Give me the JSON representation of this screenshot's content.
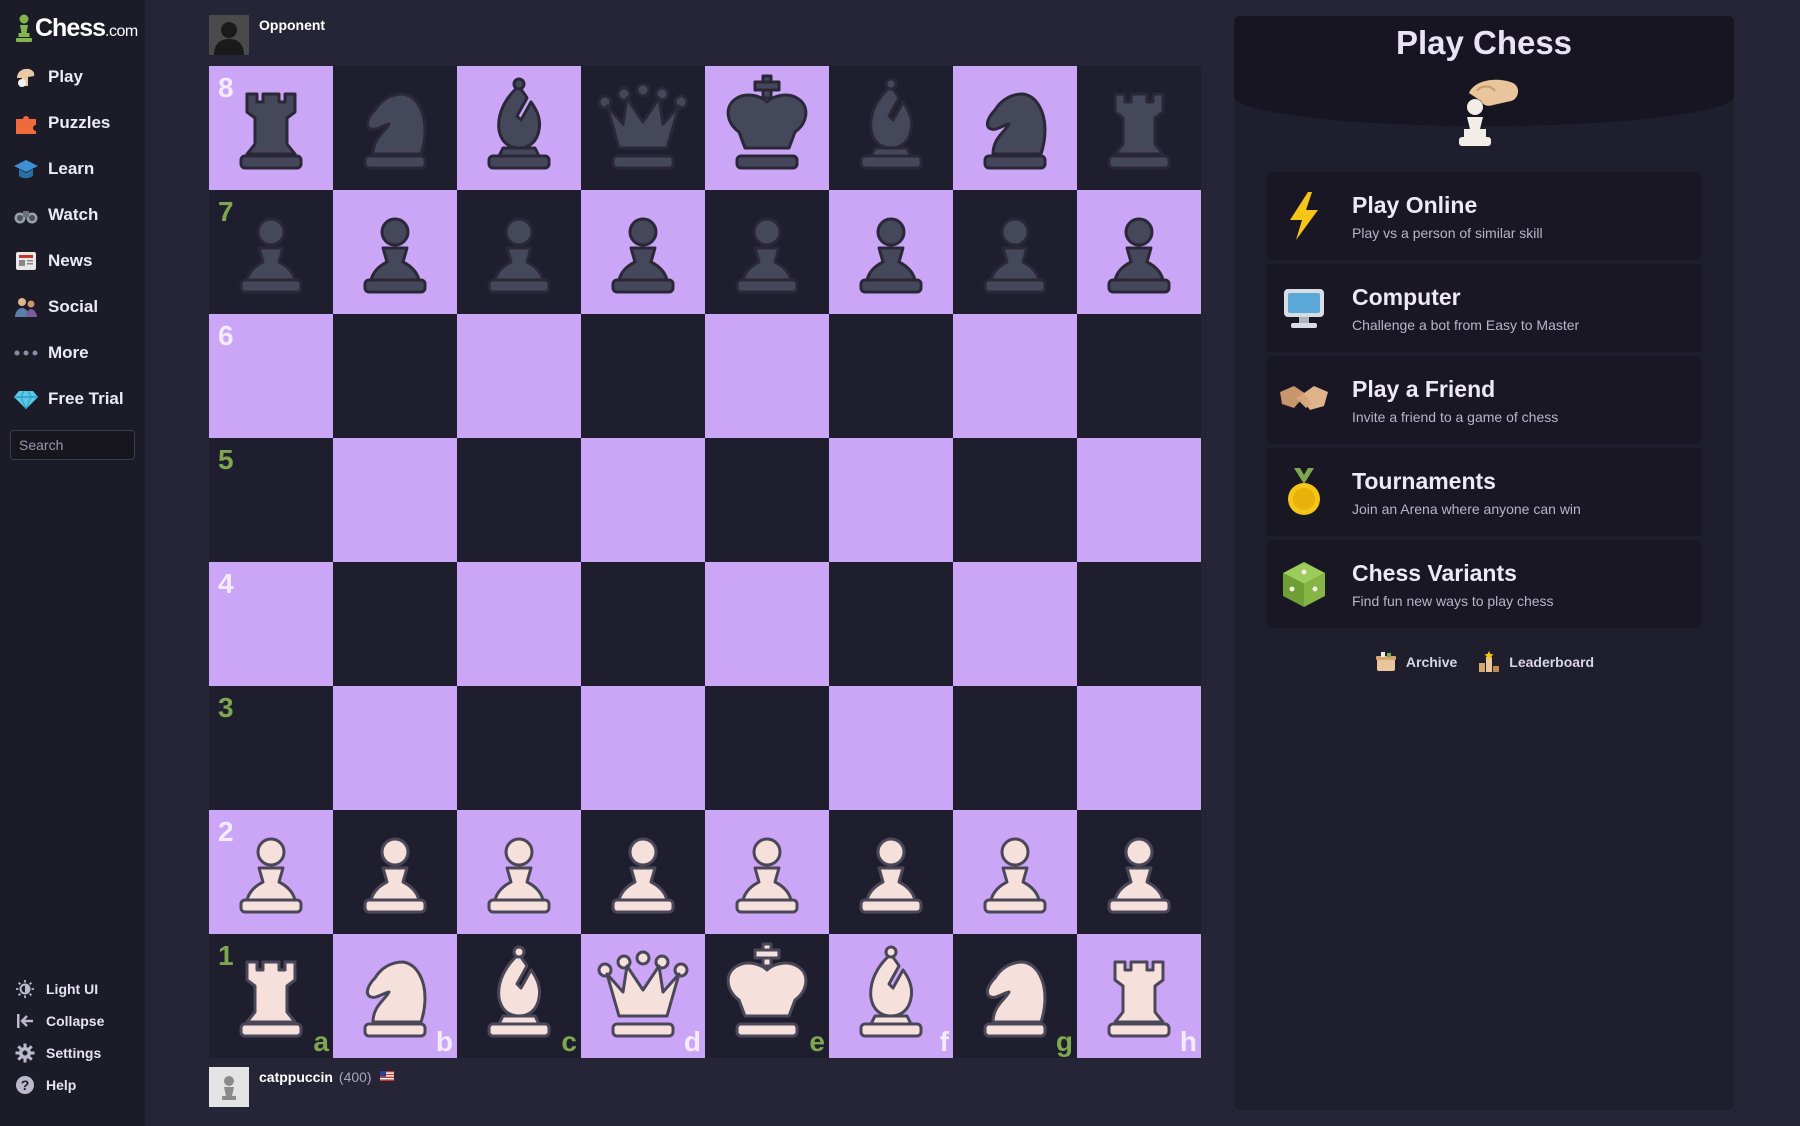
{
  "logo": {
    "brand": "Chess",
    "suffix": ".com"
  },
  "nav": [
    {
      "label": "Play",
      "icon": "play-hand-icon"
    },
    {
      "label": "Puzzles",
      "icon": "puzzle-icon"
    },
    {
      "label": "Learn",
      "icon": "learn-cap-icon"
    },
    {
      "label": "Watch",
      "icon": "binoculars-icon"
    },
    {
      "label": "News",
      "icon": "newspaper-icon"
    },
    {
      "label": "Social",
      "icon": "people-icon"
    },
    {
      "label": "More",
      "icon": "more-dots-icon"
    },
    {
      "label": "Free Trial",
      "icon": "diamond-icon"
    }
  ],
  "search": {
    "placeholder": "Search"
  },
  "bottom_nav": [
    {
      "label": "Light UI",
      "icon": "sun-icon"
    },
    {
      "label": "Collapse",
      "icon": "collapse-icon"
    },
    {
      "label": "Settings",
      "icon": "gear-icon"
    },
    {
      "label": "Help",
      "icon": "help-icon"
    }
  ],
  "opponent": {
    "name": "Opponent"
  },
  "player": {
    "name": "catppuccin",
    "rating": "(400)",
    "flag": "us-flag-icon"
  },
  "board": {
    "light_color": "#cba6f7",
    "dark_color": "#1f1e2e",
    "white_piece_color": "#f5e0dc",
    "black_piece_color": "#45475a",
    "ranks": [
      "8",
      "7",
      "6",
      "5",
      "4",
      "3",
      "2",
      "1"
    ],
    "files": [
      "a",
      "b",
      "c",
      "d",
      "e",
      "f",
      "g",
      "h"
    ],
    "position": [
      [
        "br",
        "bn",
        "bb",
        "bq",
        "bk",
        "bb",
        "bn",
        "br"
      ],
      [
        "bp",
        "bp",
        "bp",
        "bp",
        "bp",
        "bp",
        "bp",
        "bp"
      ],
      [
        "",
        "",
        "",
        "",
        "",
        "",
        "",
        ""
      ],
      [
        "",
        "",
        "",
        "",
        "",
        "",
        "",
        ""
      ],
      [
        "",
        "",
        "",
        "",
        "",
        "",
        "",
        ""
      ],
      [
        "",
        "",
        "",
        "",
        "",
        "",
        "",
        ""
      ],
      [
        "wp",
        "wp",
        "wp",
        "wp",
        "wp",
        "wp",
        "wp",
        "wp"
      ],
      [
        "wr",
        "wn",
        "wb",
        "wq",
        "wk",
        "wb",
        "wn",
        "wr"
      ]
    ]
  },
  "panel": {
    "title": "Play Chess",
    "options": [
      {
        "title": "Play Online",
        "desc": "Play vs a person of similar skill",
        "icon": "lightning-icon"
      },
      {
        "title": "Computer",
        "desc": "Challenge a bot from Easy to Master",
        "icon": "computer-icon"
      },
      {
        "title": "Play a Friend",
        "desc": "Invite a friend to a game of chess",
        "icon": "handshake-icon"
      },
      {
        "title": "Tournaments",
        "desc": "Join an Arena where anyone can win",
        "icon": "medal-icon"
      },
      {
        "title": "Chess Variants",
        "desc": "Find fun new ways to play chess",
        "icon": "variants-cube-icon"
      }
    ],
    "links": [
      {
        "label": "Archive",
        "icon": "archive-icon"
      },
      {
        "label": "Leaderboard",
        "icon": "leaderboard-icon"
      }
    ]
  }
}
